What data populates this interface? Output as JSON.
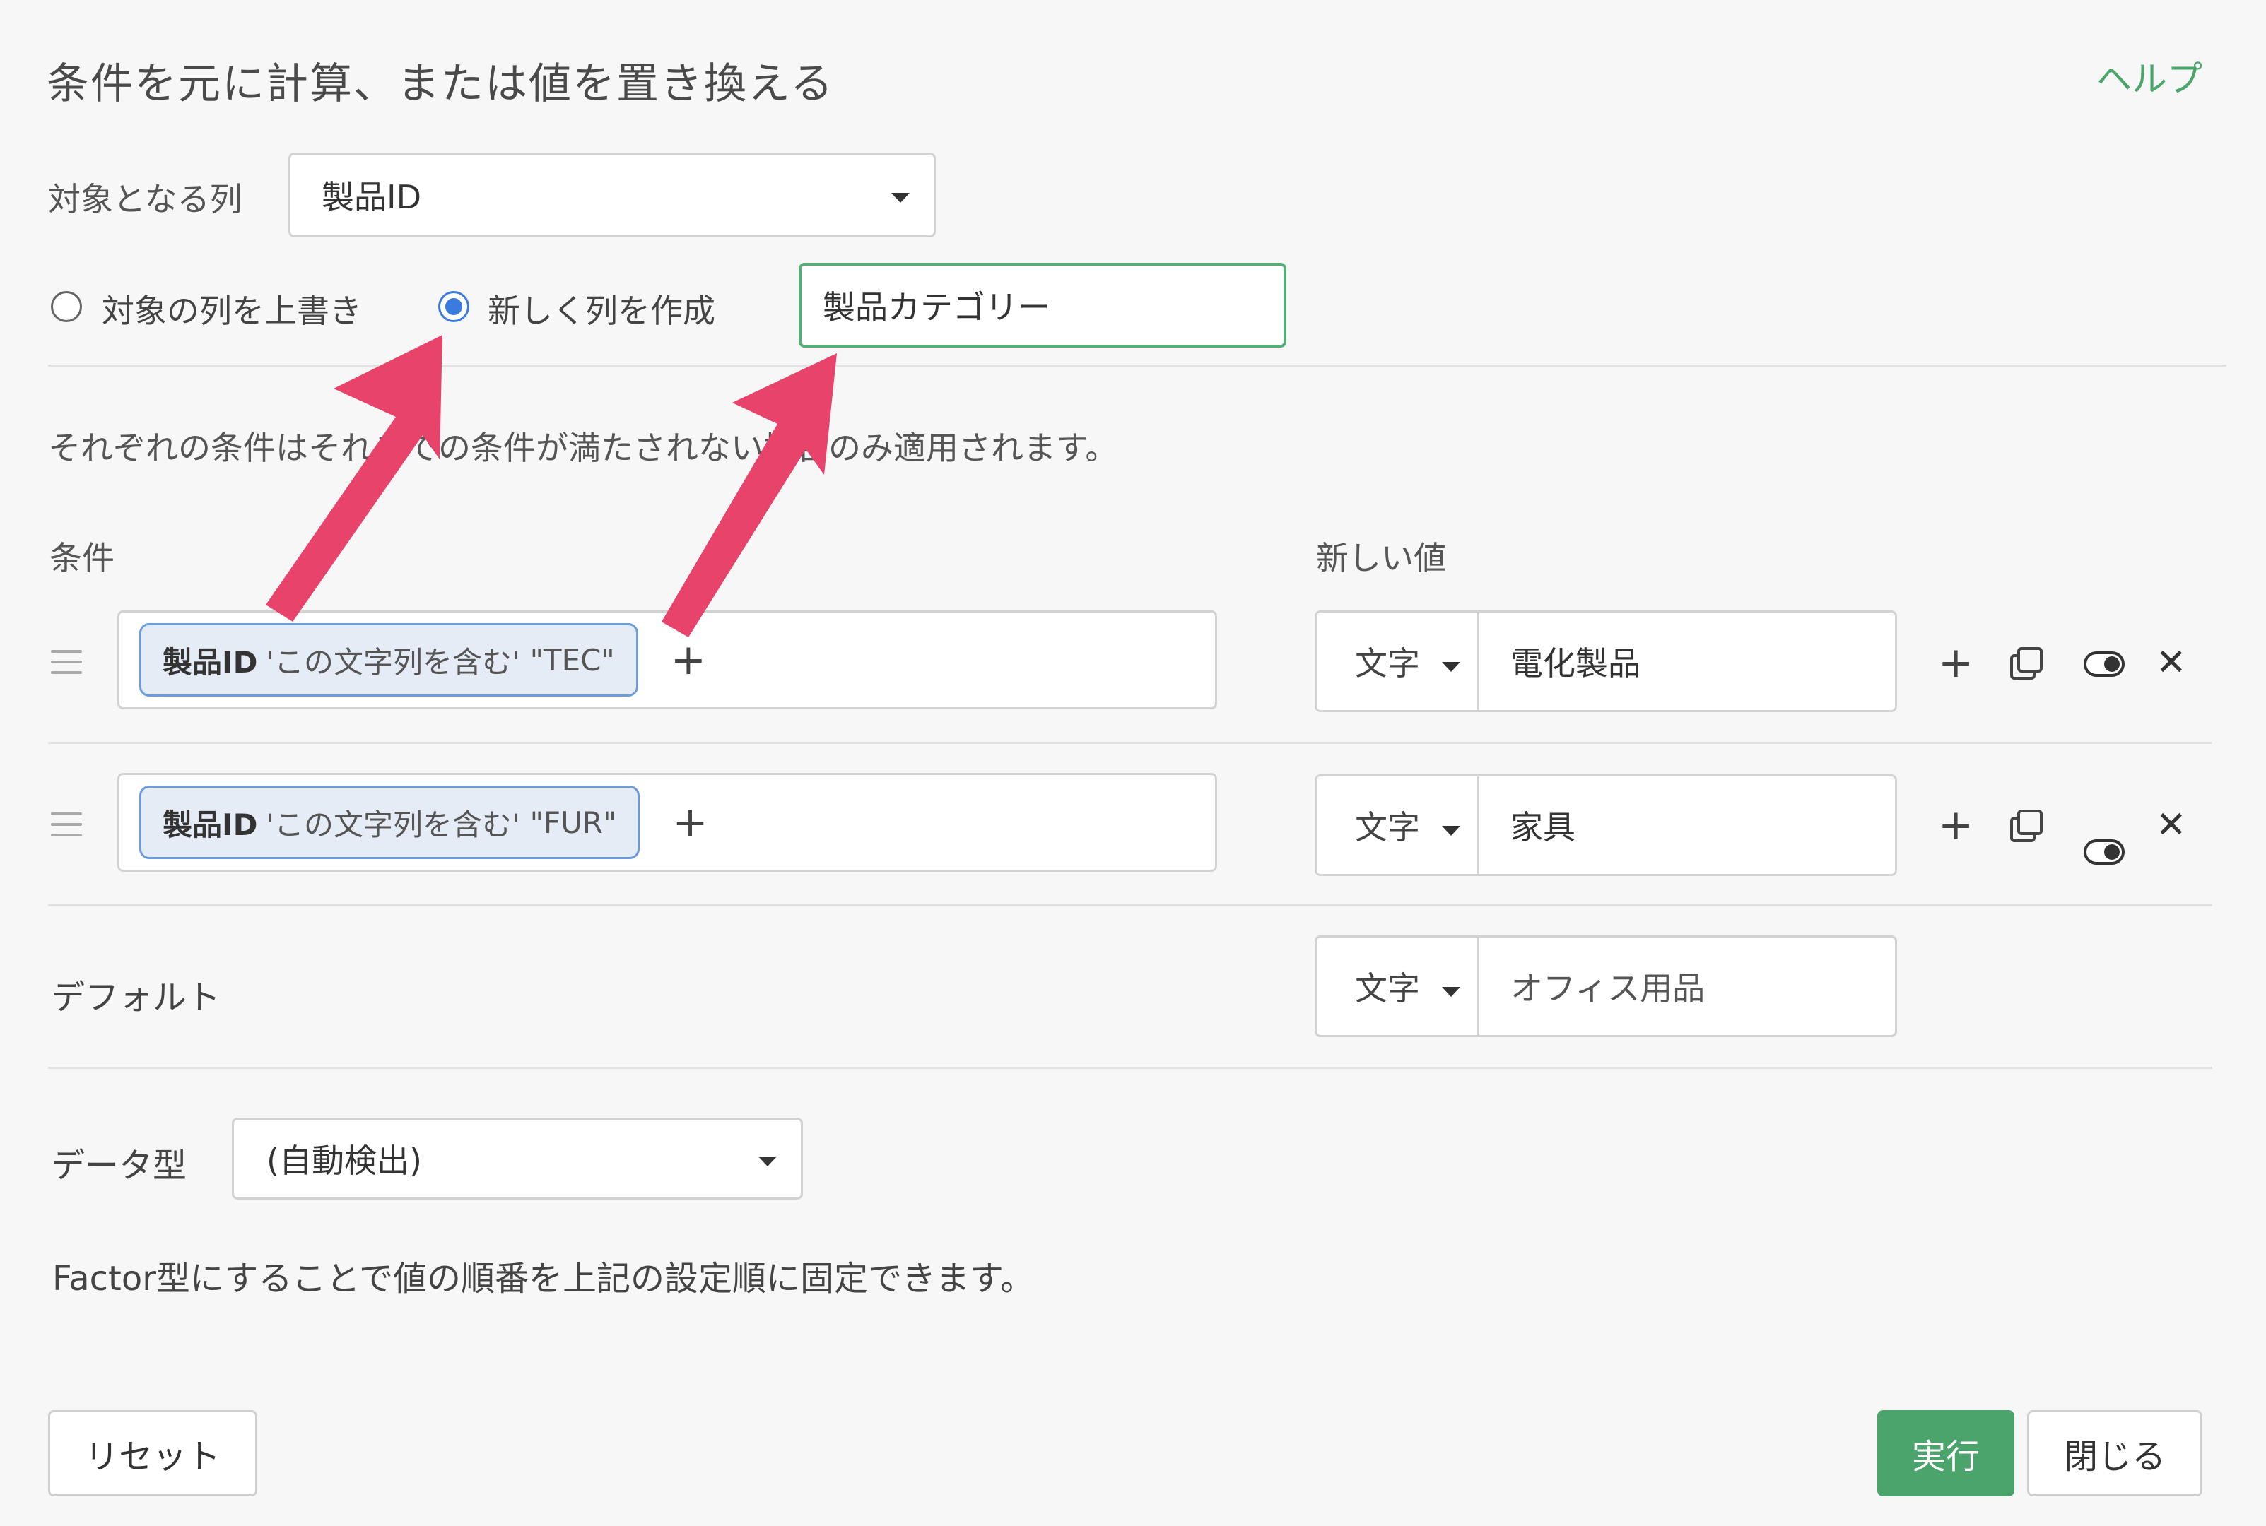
{
  "header": {
    "title": "条件を元に計算、または値を置き換える",
    "help": "ヘルプ"
  },
  "target": {
    "label": "対象となる列",
    "selected": "製品ID"
  },
  "mode": {
    "overwrite_label": "対象の列を上書き",
    "new_label": "新しく列を作成",
    "selected": "new",
    "new_column_name": "製品カテゴリー"
  },
  "note": "それぞれの条件はそれまでの条件が満たされない場合のみ適用されます。",
  "columns": {
    "condition": "条件",
    "new_value": "新しい値"
  },
  "rules": [
    {
      "column": "製品ID",
      "operator": "'この文字列を含む'",
      "value": "\"TEC\"",
      "type": "文字",
      "new_value": "電化製品"
    },
    {
      "column": "製品ID",
      "operator": "'この文字列を含む'",
      "value": "\"FUR\"",
      "type": "文字",
      "new_value": "家具"
    }
  ],
  "default": {
    "label": "デフォルト",
    "type": "文字",
    "value": "オフィス用品"
  },
  "datatype": {
    "label": "データ型",
    "selected": "(自動検出)",
    "hint": "Factor型にすることで値の順番を上記の設定順に固定できます。"
  },
  "footer": {
    "reset": "リセット",
    "run": "実行",
    "close": "閉じる"
  },
  "colors": {
    "accent": "#4ca46d",
    "radio": "#3a7be0",
    "annotation_arrow": "#e8436b"
  },
  "icons": {
    "add": "plus-icon",
    "duplicate": "copy-icon",
    "toggle": "toggle-icon",
    "delete": "close-icon",
    "drag": "drag-handle-icon"
  }
}
